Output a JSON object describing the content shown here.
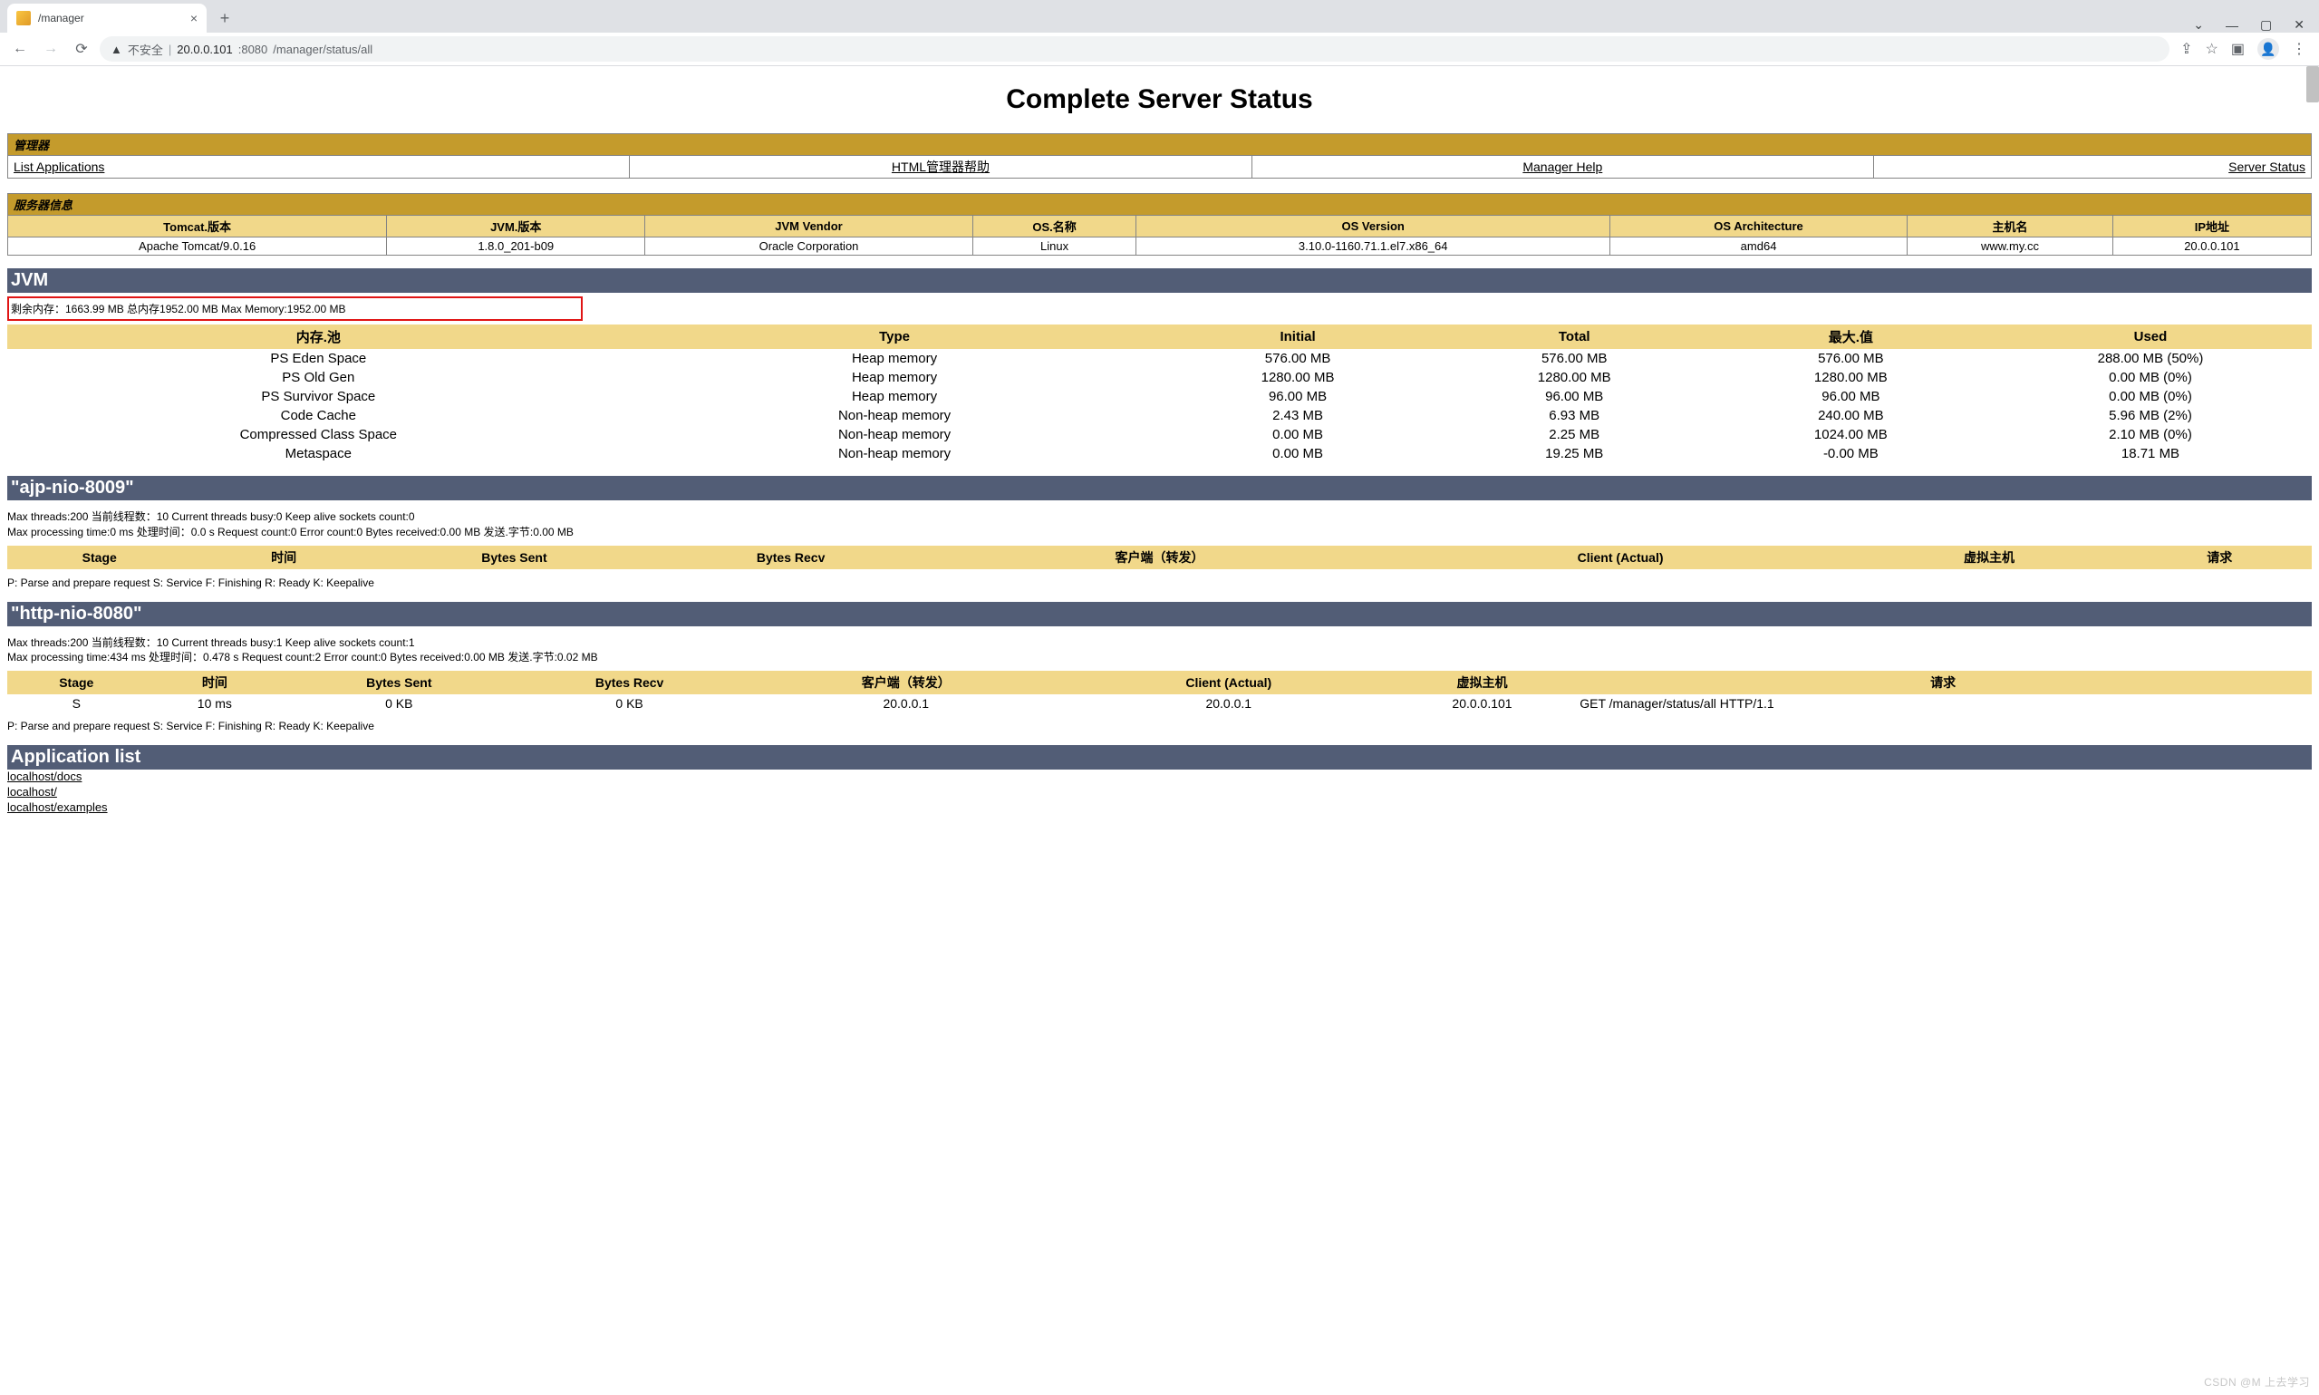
{
  "browser": {
    "tab_title": "/manager",
    "insecure_label": "不安全",
    "url_host": "20.0.0.101",
    "url_port": ":8080",
    "url_path": "/manager/status/all"
  },
  "page": {
    "title": "Complete Server Status",
    "manager_section": "管理器",
    "links": {
      "list_apps": "List Applications",
      "html_help": "HTML管理器帮助",
      "mgr_help": "Manager Help",
      "server_status": "Server Status"
    },
    "server_section": "服务器信息",
    "server_headers": [
      "Tomcat.版本",
      "JVM.版本",
      "JVM Vendor",
      "OS.名称",
      "OS Version",
      "OS Architecture",
      "主机名",
      "IP地址"
    ],
    "server_row": [
      "Apache Tomcat/9.0.16",
      "1.8.0_201-b09",
      "Oracle Corporation",
      "Linux",
      "3.10.0-1160.71.1.el7.x86_64",
      "amd64",
      "www.my.cc",
      "20.0.0.101"
    ],
    "jvm_bar": "JVM",
    "jvm_mem_line": "剩余内存：1663.99 MB 总内存1952.00 MB Max Memory:1952.00 MB",
    "pool_headers": [
      "内存.池",
      "Type",
      "Initial",
      "Total",
      "最大.值",
      "Used"
    ],
    "pools": [
      [
        "PS Eden Space",
        "Heap memory",
        "576.00 MB",
        "576.00 MB",
        "576.00 MB",
        "288.00 MB (50%)"
      ],
      [
        "PS Old Gen",
        "Heap memory",
        "1280.00 MB",
        "1280.00 MB",
        "1280.00 MB",
        "0.00 MB (0%)"
      ],
      [
        "PS Survivor Space",
        "Heap memory",
        "96.00 MB",
        "96.00 MB",
        "96.00 MB",
        "0.00 MB (0%)"
      ],
      [
        "Code Cache",
        "Non-heap memory",
        "2.43 MB",
        "6.93 MB",
        "240.00 MB",
        "5.96 MB (2%)"
      ],
      [
        "Compressed Class Space",
        "Non-heap memory",
        "0.00 MB",
        "2.25 MB",
        "1024.00 MB",
        "2.10 MB (0%)"
      ],
      [
        "Metaspace",
        "Non-heap memory",
        "0.00 MB",
        "19.25 MB",
        "-0.00 MB",
        "18.71 MB"
      ]
    ],
    "conn1_bar": "\"ajp-nio-8009\"",
    "conn1_l1": "Max threads:200 当前线程数：10 Current threads busy:0 Keep alive sockets count:0",
    "conn1_l2": "Max processing time:0 ms 处理时间：0.0 s Request count:0 Error count:0 Bytes received:0.00 MB 发送.字节:0.00 MB",
    "conn1_headers": [
      "Stage",
      "时间",
      "Bytes Sent",
      "Bytes Recv",
      "客户端（转发）",
      "Client (Actual)",
      "虚拟主机",
      "请求"
    ],
    "legend": "P: Parse and prepare request S: Service F: Finishing R: Ready K: Keepalive",
    "conn2_bar": "\"http-nio-8080\"",
    "conn2_l1": "Max threads:200 当前线程数：10 Current threads busy:1 Keep alive sockets count:1",
    "conn2_l2": "Max processing time:434 ms 处理时间：0.478 s Request count:2 Error count:0 Bytes received:0.00 MB 发送.字节:0.02 MB",
    "conn2_headers": [
      "Stage",
      "时间",
      "Bytes Sent",
      "Bytes Recv",
      "客户端（转发）",
      "Client (Actual)",
      "虚拟主机",
      "请求"
    ],
    "conn2_row": [
      "S",
      "10 ms",
      "0 KB",
      "0 KB",
      "20.0.0.1",
      "20.0.0.1",
      "20.0.0.101",
      "GET /manager/status/all HTTP/1.1"
    ],
    "app_bar": "Application list",
    "apps": [
      "localhost/docs",
      "localhost/",
      "localhost/examples"
    ],
    "watermark": "CSDN @M 上去学习"
  }
}
